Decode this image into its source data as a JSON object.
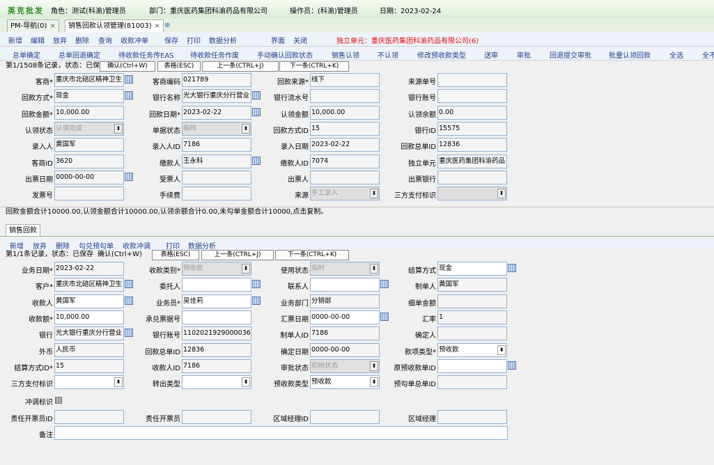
{
  "topbar": {
    "brand": "英克批发",
    "role": "角色：测试(科渝)管理员",
    "dept": "部门：重庆医药集团科渝药品有限公司",
    "operator": "操作员：(科渝)管理员",
    "date": "日期：2023-02-24"
  },
  "tabs": [
    {
      "label": "PM-导航(0)",
      "close": "×"
    },
    {
      "label": "销售回款认领管理(81003)",
      "close": "×"
    },
    {
      "label": "⊕"
    }
  ],
  "toolbar": {
    "items": [
      "新增",
      "编辑",
      "放弃",
      "删除",
      "查询",
      "收款冲单",
      "保存",
      "打印",
      "数据分析",
      "界面",
      "关闭"
    ],
    "unit_label": "独立单元：重庆医药集团科渝药品有限公司(6)"
  },
  "actions": [
    "总单确定",
    "总单回退确定",
    "待收款任务传EAS",
    "待收款任务作废",
    "手动确认回款状态",
    "销售认领",
    "不认领",
    "修改预收款类型",
    "送审",
    "审批",
    "回退提交审批",
    "批量认领回款",
    "全选",
    "全不"
  ],
  "nav1": {
    "status": "第1/1508条记录，状态：已保存",
    "confirm": "确认(Ctrl+W)",
    "grid": "表格(ESC)",
    "prev": "上一条(CTRL+J)",
    "next": "下一条(CTRL+K)"
  },
  "master": {
    "rows": [
      [
        {
          "label": "客商*",
          "value": "重庆市北碚区精神卫生",
          "icon": true
        },
        {
          "label": "客商编码",
          "value": "021789"
        },
        {
          "label": "回款来源*",
          "value": "线下"
        },
        {
          "label": "来源单号",
          "value": ""
        }
      ],
      [
        {
          "label": "回款方式*",
          "value": "现金",
          "icon": true
        },
        {
          "label": "银行名称",
          "value": "光大银行重庆分行营业",
          "icon": true
        },
        {
          "label": "银行流水号",
          "value": ""
        },
        {
          "label": "银行账号",
          "value": ""
        }
      ],
      [
        {
          "label": "回款金额*",
          "value": "10,000.00"
        },
        {
          "label": "回款日期*",
          "value": "2023-02-22",
          "icon": true
        },
        {
          "label": "认领金额",
          "value": "10,000.00"
        },
        {
          "label": "认领余额",
          "value": "0.00"
        }
      ],
      [
        {
          "label": "认领状态",
          "value": "认领完成",
          "gray": true,
          "dd": true
        },
        {
          "label": "单据状态",
          "value": "临时",
          "gray": true,
          "dd": true
        },
        {
          "label": "回款方式ID",
          "value": "15"
        },
        {
          "label": "银行ID",
          "value": "15575"
        }
      ],
      [
        {
          "label": "录入人",
          "value": "黄国军"
        },
        {
          "label": "录入人ID",
          "value": "7186"
        },
        {
          "label": "录入日期",
          "value": "2023-02-22"
        },
        {
          "label": "回款总单ID",
          "value": "12836"
        }
      ],
      [
        {
          "label": "客商ID",
          "value": "3620"
        },
        {
          "label": "缴款人",
          "value": "王永科",
          "icon": true
        },
        {
          "label": "缴款人ID",
          "value": "7074"
        },
        {
          "label": "独立单元",
          "value": "重庆医药集团科渝药品"
        }
      ],
      [
        {
          "label": "出票日期",
          "value": "0000-00-00",
          "icon": true
        },
        {
          "label": "受票人",
          "value": ""
        },
        {
          "label": "出票人",
          "value": ""
        },
        {
          "label": "出票银行",
          "value": ""
        }
      ],
      [
        {
          "label": "发票号",
          "value": ""
        },
        {
          "label": "手续费",
          "value": ""
        },
        {
          "label": "来源",
          "value": "手工录入",
          "gray": true,
          "dd": true
        },
        {
          "label": "三方支付标识",
          "value": "",
          "gray": true,
          "dd": true
        }
      ]
    ]
  },
  "summary": "回款金额合计10000.00,认领金额合计10000.00,认领余额合计0.00,未勾单金额合计10000,点击复制。",
  "detail_tab": "销售回款",
  "detail_toolbar": [
    "新增",
    "放弃",
    "删除",
    "勾兑预勾单",
    "收款冲调",
    "打印",
    "数据分析"
  ],
  "nav2": {
    "status": "第1/1条记录，状态：已保存",
    "confirm": "确认(Ctrl+W)",
    "grid": "表格(ESC)",
    "prev": "上一条(CTRL+J)",
    "next": "下一条(CTRL+K)"
  },
  "detail": {
    "rows": [
      [
        {
          "label": "业务日期*",
          "value": "2023-02-22"
        },
        {
          "label": "收款类别*",
          "value": "预收款",
          "gray": true,
          "dd": true
        },
        {
          "label": "使用状态",
          "value": "临时",
          "gray": true,
          "dd": true
        },
        {
          "label": "结算方式",
          "value": "现金",
          "white": true,
          "icon": true
        }
      ],
      [
        {
          "label": "客户*",
          "value": "重庆市北碚区精神卫生",
          "icon": true
        },
        {
          "label": "委托人",
          "value": "",
          "white": true,
          "icon": true
        },
        {
          "label": "联系人",
          "value": "",
          "white": true,
          "icon": true
        },
        {
          "label": "制单人",
          "value": "黄国军"
        }
      ],
      [
        {
          "label": "收款人",
          "value": "黄国军",
          "white": true,
          "icon": true
        },
        {
          "label": "业务员*",
          "value": "吴佳莉",
          "white": true,
          "icon": true
        },
        {
          "label": "业务部门",
          "value": "分销部"
        },
        {
          "label": "细单金额",
          "value": ""
        }
      ],
      [
        {
          "label": "收款额*",
          "value": "10,000.00",
          "white": true
        },
        {
          "label": "承兑票据号",
          "value": "",
          "white": true
        },
        {
          "label": "汇票日期",
          "value": "0000-00-00",
          "white": true,
          "icon": true
        },
        {
          "label": "汇率",
          "value": "1"
        }
      ],
      [
        {
          "label": "银行",
          "value": "光大银行重庆分行营业",
          "icon": true
        },
        {
          "label": "银行账号",
          "value": "1102021929000036344"
        },
        {
          "label": "制单人ID",
          "value": "7186"
        },
        {
          "label": "确定人",
          "value": ""
        }
      ],
      [
        {
          "label": "外币",
          "value": "人民币"
        },
        {
          "label": "回款总单ID",
          "value": "12836"
        },
        {
          "label": "确定日期",
          "value": "0000-00-00"
        },
        {
          "label": "款项类型*",
          "value": "预收款",
          "white": true,
          "dd": true,
          "dark": true
        }
      ],
      [
        {
          "label": "结算方式ID*",
          "value": "15"
        },
        {
          "label": "收款人ID",
          "value": "7186"
        },
        {
          "label": "审批状态",
          "value": "初始状态",
          "gray": true,
          "dd": true
        },
        {
          "label": "原预收款单ID",
          "value": "",
          "white": true,
          "icon": true
        }
      ],
      [
        {
          "label": "三方支付标识",
          "value": "",
          "white": true,
          "dd": true,
          "dark": true
        },
        {
          "label": "转出类型",
          "value": "",
          "white": true,
          "dd": true,
          "dark": true
        },
        {
          "label": "预收款类型",
          "value": "预收款",
          "white": true,
          "dd": true,
          "dark": true
        },
        {
          "label": "预勾单总单ID",
          "value": ""
        }
      ]
    ],
    "flush_label": "冲调标识",
    "resp_id_label": "责任开票员ID",
    "resp_label": "责任开票员",
    "region_id_label": "区域经理ID",
    "region_label": "区域经理",
    "remark_label": "备注"
  }
}
